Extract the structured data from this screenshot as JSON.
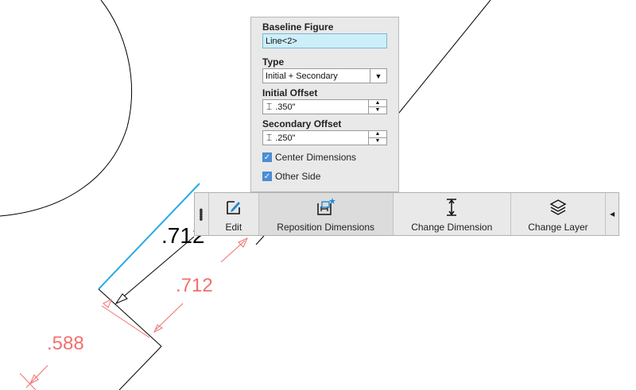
{
  "drawing": {
    "dim_black": ".712",
    "dim_red_1": ".712",
    "dim_red_2": ".588",
    "colors": {
      "selected_line": "#29aae1",
      "dimension": "#f07070",
      "geometry": "#000000"
    }
  },
  "panel": {
    "baseline_label": "Baseline Figure",
    "baseline_value": "Line<2>",
    "type_label": "Type",
    "type_value": "Initial + Secondary",
    "initial_label": "Initial Offset",
    "initial_value": ".350\"",
    "secondary_label": "Secondary Offset",
    "secondary_value": ".250\"",
    "center_label": "Center Dimensions",
    "center_checked": true,
    "other_label": "Other Side",
    "other_checked": true
  },
  "toolbar": {
    "edit_label": "Edit",
    "reposition_label": "Reposition Dimensions",
    "change_dim_label": "Change Dimension",
    "change_layer_label": "Change Layer"
  },
  "icons": {
    "grip": "vertical-dots-icon",
    "edit": "edit-pencil-icon",
    "reposition": "reposition-dimensions-icon",
    "change_dim": "dimension-arrow-icon",
    "change_layer": "layers-icon",
    "more": "triangle-left-icon"
  }
}
